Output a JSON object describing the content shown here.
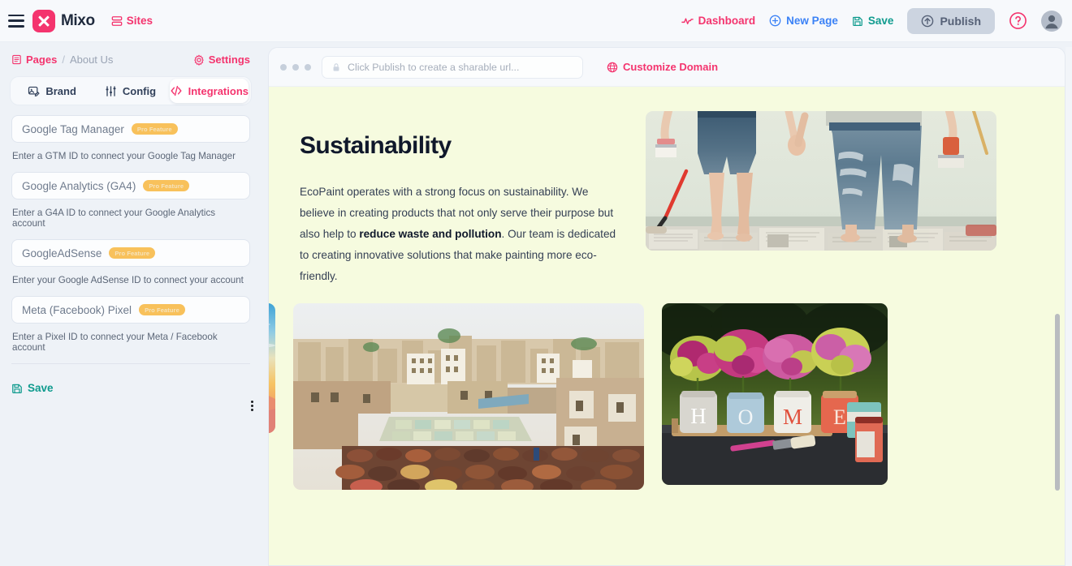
{
  "topbar": {
    "menu_icon": "hamburger-icon",
    "logo_text": "Mixo",
    "sites_label": "Sites",
    "dashboard_label": "Dashboard",
    "new_page_label": "New Page",
    "save_label": "Save",
    "publish_label": "Publish",
    "help_icon": "question-circle-icon",
    "avatar_icon": "user-avatar-icon",
    "colors": {
      "brand_pink": "#f4346e",
      "new_page_blue": "#3b82f6",
      "save_teal": "#0f9b8e",
      "publish_bg": "#ccd4e0"
    }
  },
  "sidebar": {
    "breadcrumb": {
      "root_label": "Pages",
      "separator": "/",
      "current_label": "About Us"
    },
    "settings_label": "Settings",
    "tabs": [
      {
        "label": "Brand",
        "icon": "image-edit-icon",
        "active": false
      },
      {
        "label": "Config",
        "icon": "sliders-icon",
        "active": false
      },
      {
        "label": "Integrations",
        "icon": "code-icon",
        "active": true
      }
    ],
    "fields": [
      {
        "label": "Google Tag Manager",
        "badge": "Pro Feature",
        "hint": "Enter a GTM ID to connect your Google Tag Manager"
      },
      {
        "label": "Google Analytics (GA4)",
        "badge": "Pro Feature",
        "hint": "Enter a G4A ID to connect your Google Analytics account"
      },
      {
        "label": "GoogleAdSense",
        "badge": "Pro Feature",
        "hint": "Enter your Google AdSense ID to connect your account"
      },
      {
        "label": "Meta (Facebook) Pixel",
        "badge": "Pro Feature",
        "hint": "Enter a Pixel ID to connect your Meta / Facebook account"
      }
    ],
    "overflow_icon": "more-vertical-icon",
    "save_label": "Save",
    "badge_color": "#f8c15b"
  },
  "preview": {
    "window_dots": 3,
    "url": {
      "lock_icon": "lock-icon",
      "value": "",
      "placeholder": "Click Publish to create a sharable url..."
    },
    "customize_domain_label": "Customize Domain",
    "page": {
      "background_color": "#f6fbdf",
      "title": "Sustainability",
      "paragraph_part1": "EcoPaint operates with a strong focus on sustainability. We believe in creating products that not only serve their purpose but also help to ",
      "paragraph_bold": "reduce waste and pollution",
      "paragraph_part2": ". Our team is dedicated to creating innovative solutions that make painting more eco-friendly.",
      "images": [
        {
          "name": "painters-in-denim-photo",
          "alt": "Two people in paint-splattered denim holding paintbrushes on newspaper"
        },
        {
          "name": "sunset-mountains-photo",
          "alt": "Sunset sky over layered mountain ridges"
        },
        {
          "name": "tannery-cityscape-photo",
          "alt": "Aerial view of a tannery and old city rooftops"
        },
        {
          "name": "home-mason-jars-photo",
          "alt": "Mason jars spelling HOME filled with pink and yellow flowers"
        }
      ]
    }
  }
}
